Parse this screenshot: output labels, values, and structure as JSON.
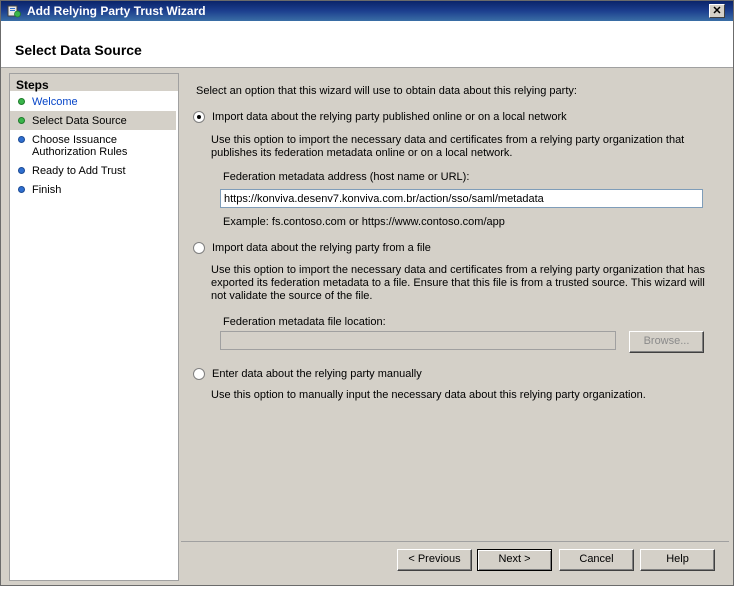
{
  "window": {
    "title": "Add Relying Party Trust Wizard",
    "close_glyph": "✕"
  },
  "header": {
    "title": "Select Data Source"
  },
  "steps": {
    "heading": "Steps",
    "items": [
      {
        "label": "Welcome",
        "state": "done"
      },
      {
        "label": "Select Data Source",
        "state": "current"
      },
      {
        "label": "Choose Issuance Authorization Rules",
        "state": "pending"
      },
      {
        "label": "Ready to Add Trust",
        "state": "pending"
      },
      {
        "label": "Finish",
        "state": "pending"
      }
    ]
  },
  "content": {
    "intro": "Select an option that this wizard will use to obtain data about this relying party:",
    "option_online": {
      "label": "Import data about the relying party published online or on a local network",
      "description": "Use this option to import the necessary data and certificates from a relying party organization that publishes its federation metadata online or on a local network.",
      "field_label": "Federation metadata address (host name or URL):",
      "field_value": "https://konviva.desenv7.konviva.com.br/action/sso/saml/metadata",
      "example": "Example: fs.contoso.com or https://www.contoso.com/app",
      "selected": true
    },
    "option_file": {
      "label": "Import data about the relying party from a file",
      "description": "Use this option to import the necessary data and certificates from a relying party organization that has exported its federation metadata to a file. Ensure that this file is from a trusted source.  This wizard will not validate the source of the file.",
      "field_label": "Federation metadata file location:",
      "field_value": "",
      "browse_label": "Browse...",
      "selected": false
    },
    "option_manual": {
      "label": "Enter data about the relying party manually",
      "description": "Use this option to manually input the necessary data about this relying party organization.",
      "selected": false
    }
  },
  "footer": {
    "previous_label": "< Previous",
    "next_label": "Next >",
    "cancel_label": "Cancel",
    "help_label": "Help"
  }
}
